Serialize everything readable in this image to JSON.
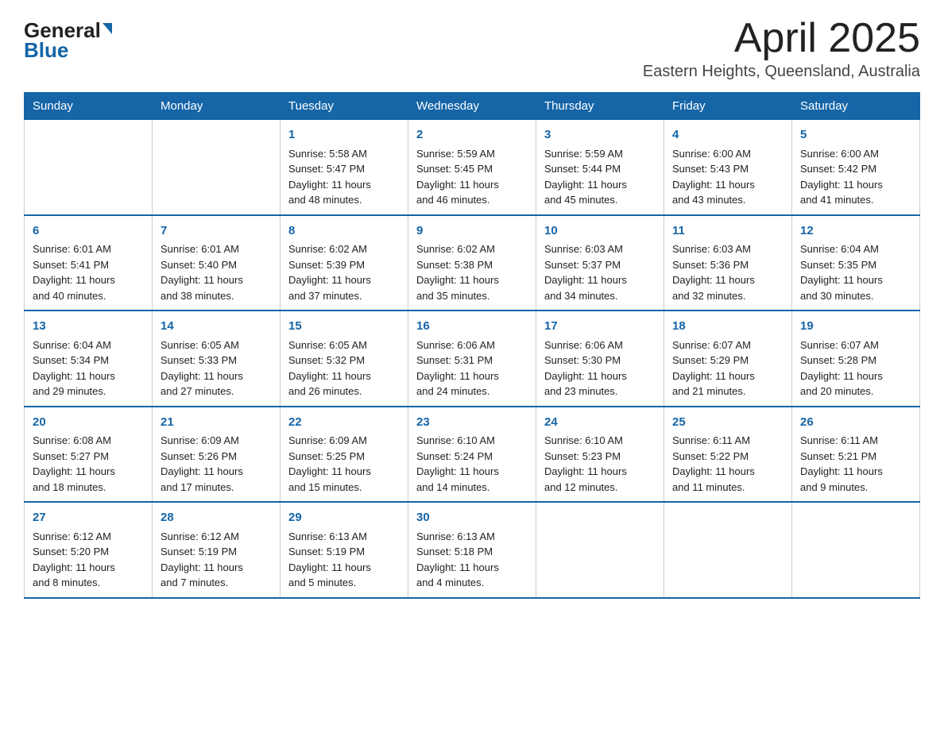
{
  "header": {
    "logo_general": "General",
    "logo_blue": "Blue",
    "month_title": "April 2025",
    "location": "Eastern Heights, Queensland, Australia"
  },
  "weekdays": [
    "Sunday",
    "Monday",
    "Tuesday",
    "Wednesday",
    "Thursday",
    "Friday",
    "Saturday"
  ],
  "weeks": [
    [
      {
        "day": "",
        "info": ""
      },
      {
        "day": "",
        "info": ""
      },
      {
        "day": "1",
        "info": "Sunrise: 5:58 AM\nSunset: 5:47 PM\nDaylight: 11 hours\nand 48 minutes."
      },
      {
        "day": "2",
        "info": "Sunrise: 5:59 AM\nSunset: 5:45 PM\nDaylight: 11 hours\nand 46 minutes."
      },
      {
        "day": "3",
        "info": "Sunrise: 5:59 AM\nSunset: 5:44 PM\nDaylight: 11 hours\nand 45 minutes."
      },
      {
        "day": "4",
        "info": "Sunrise: 6:00 AM\nSunset: 5:43 PM\nDaylight: 11 hours\nand 43 minutes."
      },
      {
        "day": "5",
        "info": "Sunrise: 6:00 AM\nSunset: 5:42 PM\nDaylight: 11 hours\nand 41 minutes."
      }
    ],
    [
      {
        "day": "6",
        "info": "Sunrise: 6:01 AM\nSunset: 5:41 PM\nDaylight: 11 hours\nand 40 minutes."
      },
      {
        "day": "7",
        "info": "Sunrise: 6:01 AM\nSunset: 5:40 PM\nDaylight: 11 hours\nand 38 minutes."
      },
      {
        "day": "8",
        "info": "Sunrise: 6:02 AM\nSunset: 5:39 PM\nDaylight: 11 hours\nand 37 minutes."
      },
      {
        "day": "9",
        "info": "Sunrise: 6:02 AM\nSunset: 5:38 PM\nDaylight: 11 hours\nand 35 minutes."
      },
      {
        "day": "10",
        "info": "Sunrise: 6:03 AM\nSunset: 5:37 PM\nDaylight: 11 hours\nand 34 minutes."
      },
      {
        "day": "11",
        "info": "Sunrise: 6:03 AM\nSunset: 5:36 PM\nDaylight: 11 hours\nand 32 minutes."
      },
      {
        "day": "12",
        "info": "Sunrise: 6:04 AM\nSunset: 5:35 PM\nDaylight: 11 hours\nand 30 minutes."
      }
    ],
    [
      {
        "day": "13",
        "info": "Sunrise: 6:04 AM\nSunset: 5:34 PM\nDaylight: 11 hours\nand 29 minutes."
      },
      {
        "day": "14",
        "info": "Sunrise: 6:05 AM\nSunset: 5:33 PM\nDaylight: 11 hours\nand 27 minutes."
      },
      {
        "day": "15",
        "info": "Sunrise: 6:05 AM\nSunset: 5:32 PM\nDaylight: 11 hours\nand 26 minutes."
      },
      {
        "day": "16",
        "info": "Sunrise: 6:06 AM\nSunset: 5:31 PM\nDaylight: 11 hours\nand 24 minutes."
      },
      {
        "day": "17",
        "info": "Sunrise: 6:06 AM\nSunset: 5:30 PM\nDaylight: 11 hours\nand 23 minutes."
      },
      {
        "day": "18",
        "info": "Sunrise: 6:07 AM\nSunset: 5:29 PM\nDaylight: 11 hours\nand 21 minutes."
      },
      {
        "day": "19",
        "info": "Sunrise: 6:07 AM\nSunset: 5:28 PM\nDaylight: 11 hours\nand 20 minutes."
      }
    ],
    [
      {
        "day": "20",
        "info": "Sunrise: 6:08 AM\nSunset: 5:27 PM\nDaylight: 11 hours\nand 18 minutes."
      },
      {
        "day": "21",
        "info": "Sunrise: 6:09 AM\nSunset: 5:26 PM\nDaylight: 11 hours\nand 17 minutes."
      },
      {
        "day": "22",
        "info": "Sunrise: 6:09 AM\nSunset: 5:25 PM\nDaylight: 11 hours\nand 15 minutes."
      },
      {
        "day": "23",
        "info": "Sunrise: 6:10 AM\nSunset: 5:24 PM\nDaylight: 11 hours\nand 14 minutes."
      },
      {
        "day": "24",
        "info": "Sunrise: 6:10 AM\nSunset: 5:23 PM\nDaylight: 11 hours\nand 12 minutes."
      },
      {
        "day": "25",
        "info": "Sunrise: 6:11 AM\nSunset: 5:22 PM\nDaylight: 11 hours\nand 11 minutes."
      },
      {
        "day": "26",
        "info": "Sunrise: 6:11 AM\nSunset: 5:21 PM\nDaylight: 11 hours\nand 9 minutes."
      }
    ],
    [
      {
        "day": "27",
        "info": "Sunrise: 6:12 AM\nSunset: 5:20 PM\nDaylight: 11 hours\nand 8 minutes."
      },
      {
        "day": "28",
        "info": "Sunrise: 6:12 AM\nSunset: 5:19 PM\nDaylight: 11 hours\nand 7 minutes."
      },
      {
        "day": "29",
        "info": "Sunrise: 6:13 AM\nSunset: 5:19 PM\nDaylight: 11 hours\nand 5 minutes."
      },
      {
        "day": "30",
        "info": "Sunrise: 6:13 AM\nSunset: 5:18 PM\nDaylight: 11 hours\nand 4 minutes."
      },
      {
        "day": "",
        "info": ""
      },
      {
        "day": "",
        "info": ""
      },
      {
        "day": "",
        "info": ""
      }
    ]
  ]
}
